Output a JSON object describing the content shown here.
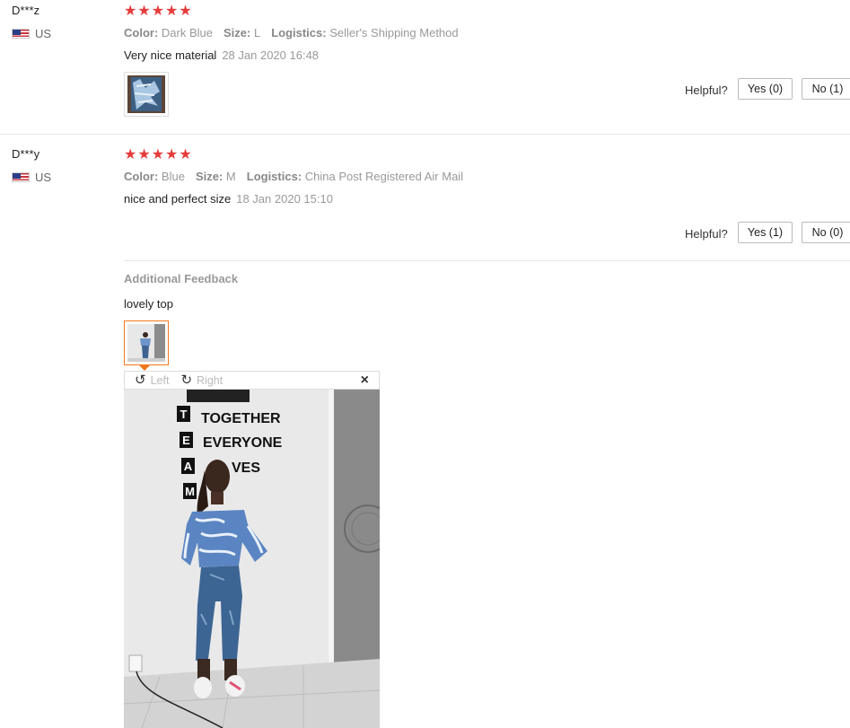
{
  "reviews": [
    {
      "user": "D***z",
      "country": "US",
      "rating_stars": "★★★★★",
      "color_label": "Color:",
      "color_value": "Dark Blue",
      "size_label": "Size:",
      "size_value": "L",
      "logistics_label": "Logistics:",
      "logistics_value": "Seller's Shipping Method",
      "text": "Very nice material",
      "date": "28 Jan 2020 16:48",
      "helpful_label": "Helpful?",
      "yes": "Yes (0)",
      "no": "No (1)"
    },
    {
      "user": "D***y",
      "country": "US",
      "rating_stars": "★★★★★",
      "color_label": "Color:",
      "color_value": "Blue",
      "size_label": "Size:",
      "size_value": "M",
      "logistics_label": "Logistics:",
      "logistics_value": "China Post Registered Air Mail",
      "text": "nice and perfect size",
      "date": "18 Jan 2020 15:10",
      "helpful_label": "Helpful?",
      "yes": "Yes (1)",
      "no": "No (0)"
    }
  ],
  "additional_feedback": {
    "heading": "Additional Feedback",
    "text": "lovely top"
  },
  "viewer": {
    "rotate_left": "Left",
    "rotate_right": "Right",
    "close": "×",
    "wall_letters": [
      "T",
      "E",
      "A",
      "M"
    ],
    "wall_words": [
      "TOGETHER",
      "EVERYONE",
      "ACHIEVES",
      ""
    ]
  },
  "colors": {
    "stars": "#e63b3b",
    "active_thumb": "#f0781e"
  }
}
